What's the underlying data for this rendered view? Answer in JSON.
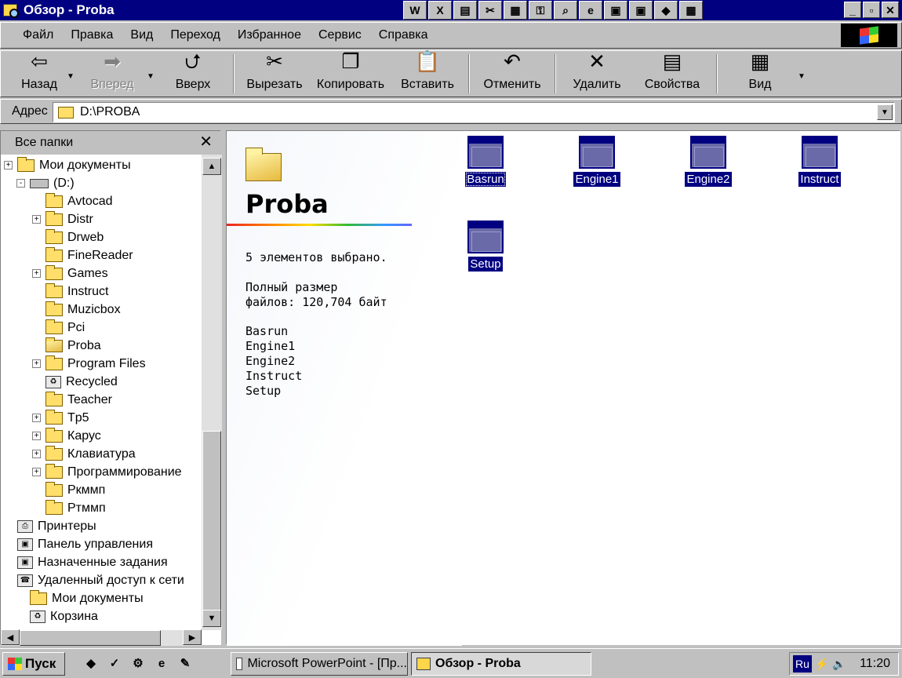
{
  "window": {
    "title": "Обзор - Proba"
  },
  "quick_buttons": [
    "W",
    "X",
    "▤",
    "✂",
    "▦",
    "⚿",
    "⌕",
    "e",
    "▣",
    "▣",
    "◆",
    "▦"
  ],
  "window_controls": {
    "minimize": "_",
    "maximize": "▫",
    "close": "✕"
  },
  "menu": [
    "Файл",
    "Правка",
    "Вид",
    "Переход",
    "Избранное",
    "Сервис",
    "Справка"
  ],
  "toolbar": {
    "back": "Назад",
    "forward": "Вперед",
    "up": "Вверх",
    "cut": "Вырезать",
    "copy": "Копировать",
    "paste": "Вставить",
    "undo": "Отменить",
    "delete": "Удалить",
    "properties": "Свойства",
    "view": "Вид"
  },
  "address": {
    "label": "Адрес",
    "value": "D:\\PROBA"
  },
  "left_pane": {
    "header": "Все папки",
    "close": "✕",
    "tree": [
      {
        "label": "Мои документы",
        "expander": "+",
        "icon": "documents"
      },
      {
        "label": "(D:)",
        "expander": "-",
        "icon": "drive"
      },
      {
        "label": "Avtocad",
        "expander": "",
        "icon": "folder"
      },
      {
        "label": "Distr",
        "expander": "+",
        "icon": "folder"
      },
      {
        "label": "Drweb",
        "expander": "",
        "icon": "folder"
      },
      {
        "label": "FineReader",
        "expander": "",
        "icon": "folder"
      },
      {
        "label": "Games",
        "expander": "+",
        "icon": "folder"
      },
      {
        "label": "Instruct",
        "expander": "",
        "icon": "folder"
      },
      {
        "label": "Muzicbox",
        "expander": "",
        "icon": "folder"
      },
      {
        "label": "Pci",
        "expander": "",
        "icon": "folder"
      },
      {
        "label": "Proba",
        "expander": "",
        "icon": "folder-open"
      },
      {
        "label": "Program Files",
        "expander": "+",
        "icon": "folder"
      },
      {
        "label": "Recycled",
        "expander": "",
        "icon": "recycle"
      },
      {
        "label": "Teacher",
        "expander": "",
        "icon": "folder"
      },
      {
        "label": "Tp5",
        "expander": "+",
        "icon": "folder"
      },
      {
        "label": "Карус",
        "expander": "+",
        "icon": "folder"
      },
      {
        "label": "Клавиатура",
        "expander": "+",
        "icon": "folder"
      },
      {
        "label": "Программирование",
        "expander": "+",
        "icon": "folder"
      },
      {
        "label": "Ркммп",
        "expander": "",
        "icon": "folder"
      },
      {
        "label": "Ртммп",
        "expander": "",
        "icon": "folder"
      },
      {
        "label": "Принтеры",
        "expander": "",
        "icon": "printers"
      },
      {
        "label": "Панель управления",
        "expander": "",
        "icon": "control-panel"
      },
      {
        "label": "Назначенные задания",
        "expander": "",
        "icon": "scheduled"
      },
      {
        "label": "Удаленный доступ к сети",
        "expander": "",
        "icon": "dialup"
      },
      {
        "label": "Мои документы",
        "expander": "",
        "icon": "documents"
      },
      {
        "label": "Корзина",
        "expander": "",
        "icon": "recycle"
      }
    ]
  },
  "right_pane": {
    "folder_title": "Proba",
    "selected_text": "5 элементов выбрано.",
    "size_text": "Полный размер\nфайлов: 120,704 байт",
    "selected_files": [
      "Basrun",
      "Engine1",
      "Engine2",
      "Instruct",
      "Setup"
    ],
    "icons": [
      "Basrun",
      "Engine1",
      "Engine2",
      "Instruct",
      "Setup"
    ]
  },
  "taskbar": {
    "start": "Пуск",
    "quick_launch": [
      "◆",
      "✓",
      "⚙",
      "e",
      "✎"
    ],
    "tasks": [
      "Microsoft PowerPoint - [Пр...",
      "Обзор - Proba"
    ],
    "lang": "Ru",
    "clock": "11:20"
  }
}
